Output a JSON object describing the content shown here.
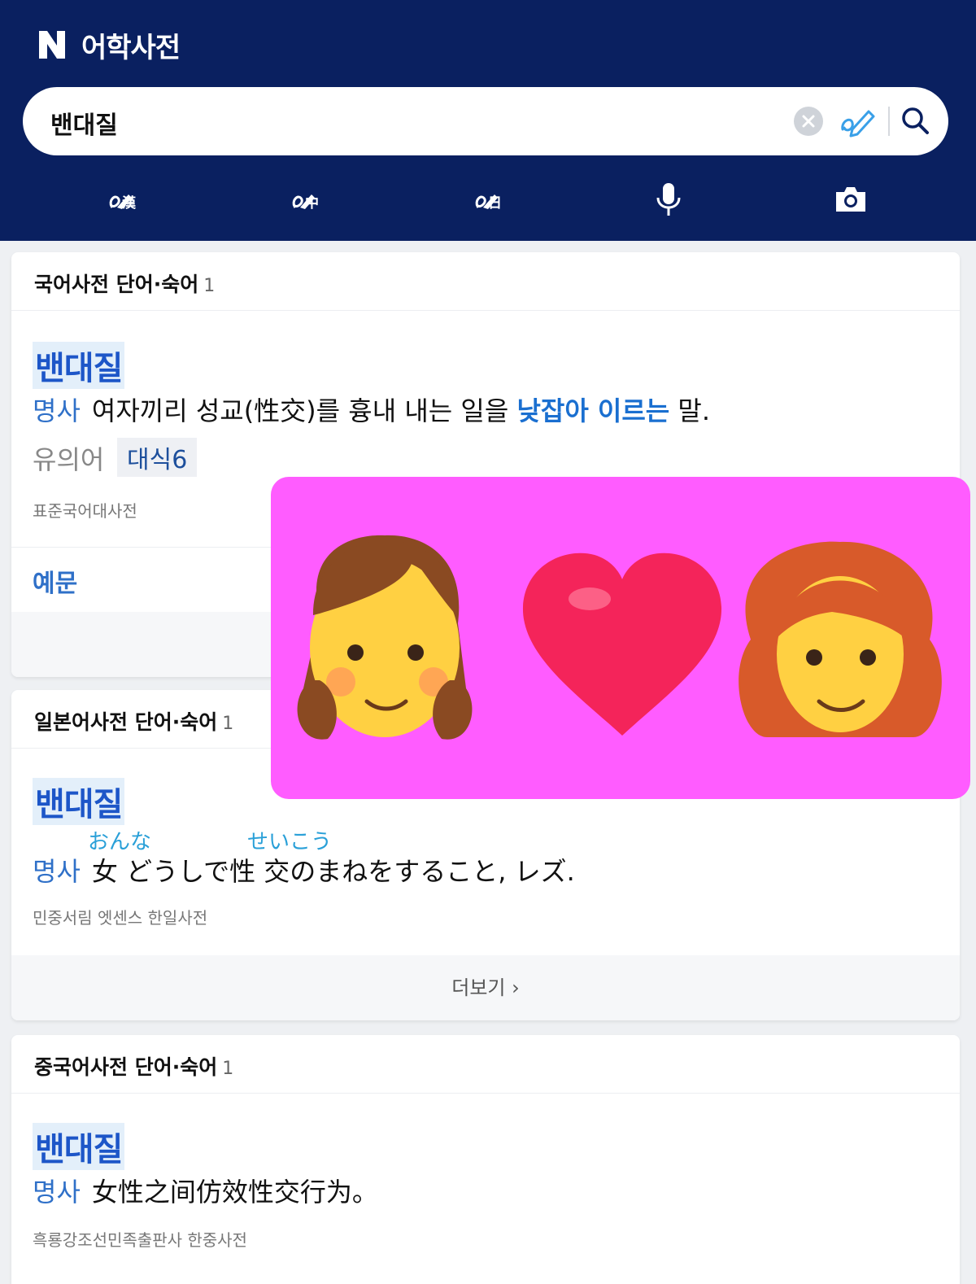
{
  "header": {
    "brand_title": "어학사전",
    "search_value": "밴대질",
    "tools": [
      {
        "name": "hanja-handwriting-tool",
        "sub": "漢"
      },
      {
        "name": "chinese-handwriting-tool",
        "sub": "中"
      },
      {
        "name": "japanese-handwriting-tool",
        "sub": "日"
      },
      {
        "name": "voice-search-tool",
        "sub": ""
      },
      {
        "name": "camera-search-tool",
        "sub": ""
      }
    ]
  },
  "cards": [
    {
      "title": "국어사전 단어·숙어",
      "count": "1",
      "word": "밴대질",
      "pos": "명사",
      "def_before": "여자끼리 성교(性交)를 흉내 내는 일을 ",
      "def_highlight": "낮잡아 이르는",
      "def_after": " 말.",
      "syn_label": "유의어",
      "syn_value": "대식6",
      "source": "표준국어대사전",
      "example_tab": "예문"
    },
    {
      "title": "일본어사전 단어·숙어",
      "count": "1",
      "word": "밴대질",
      "pos": "명사",
      "furigana_1": "おんな",
      "furigana_2": "せいこう",
      "definition": "女 どうしで性  交のまねをすること, レズ.",
      "source": "민중서림 엣센스 한일사전",
      "more": "더보기 ›"
    },
    {
      "title": "중국어사전 단어·숙어",
      "count": "1",
      "word": "밴대질",
      "pos": "명사",
      "definition": "女性之间仿效性交行为。",
      "source": "흑룡강조선민족출판사 한중사전"
    }
  ],
  "overlay": {
    "background": "#ff5cff",
    "emojis": [
      "girl-emoji",
      "red-heart-emoji",
      "woman-red-hair-emoji"
    ]
  },
  "colors": {
    "header": "#0a2060",
    "accent_blue": "#1d56c8",
    "link_blue": "#1a6fd0"
  }
}
